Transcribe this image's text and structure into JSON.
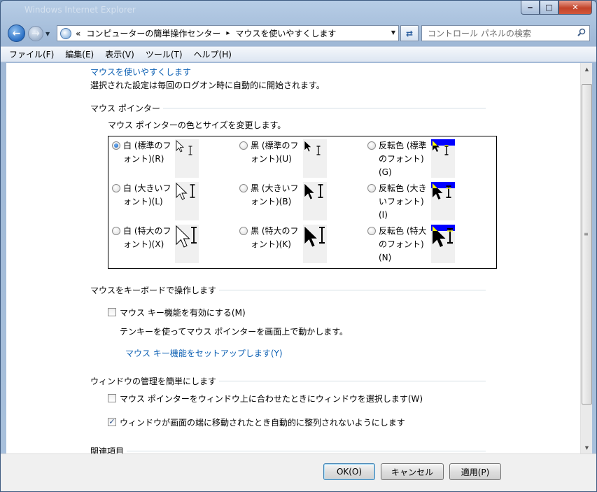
{
  "window": {
    "title": "Windows Internet Explorer"
  },
  "nav": {
    "breadcrumb": [
      "コンピューターの簡単操作センター",
      "マウスを使いやすくします"
    ],
    "breadcrumb_prefix": "«",
    "search_placeholder": "コントロール パネルの検索"
  },
  "menu": {
    "items": [
      "ファイル(F)",
      "編集(E)",
      "表示(V)",
      "ツール(T)",
      "ヘルプ(H)"
    ]
  },
  "page": {
    "title": "マウスを使いやすくします",
    "subtitle": "選択された設定は毎回のログオン時に自動的に開始されます。"
  },
  "pointer_section": {
    "heading": "マウス ポインター",
    "description": "マウス ポインターの色とサイズを変更します。",
    "options": [
      {
        "label": "白 (標準のフォント)(R)",
        "selected": true,
        "style": "white",
        "size": "normal"
      },
      {
        "label": "黒 (標準のフォント)(U)",
        "selected": false,
        "style": "black",
        "size": "normal"
      },
      {
        "label": "反転色 (標準のフォント)(G)",
        "selected": false,
        "style": "inverted",
        "size": "normal"
      },
      {
        "label": "白 (大きいフォント)(L)",
        "selected": false,
        "style": "white",
        "size": "large"
      },
      {
        "label": "黒 (大きいフォント)(B)",
        "selected": false,
        "style": "black",
        "size": "large"
      },
      {
        "label": "反転色 (大きいフォント)(I)",
        "selected": false,
        "style": "inverted",
        "size": "large"
      },
      {
        "label": "白 (特大のフォント)(X)",
        "selected": false,
        "style": "white",
        "size": "xlarge"
      },
      {
        "label": "黒 (特大のフォント)(K)",
        "selected": false,
        "style": "black",
        "size": "xlarge"
      },
      {
        "label": "反転色 (特大のフォント)(N)",
        "selected": false,
        "style": "inverted",
        "size": "xlarge"
      }
    ]
  },
  "keyboard_section": {
    "heading": "マウスをキーボードで操作します",
    "mousekeys_label": "マウス キー機能を有効にする(M)",
    "mousekeys_checked": false,
    "mousekeys_description": "テンキーを使ってマウス ポインターを画面上で動かします。",
    "setup_link": "マウス キー機能をセットアップします(Y)"
  },
  "window_section": {
    "heading": "ウィンドウの管理を簡単にします",
    "hover_activate_label": "マウス ポインターをウィンドウ上に合わせたときにウィンドウを選択します(W)",
    "hover_activate_checked": false,
    "prevent_arrange_label": "ウィンドウが画面の端に移動されたとき自動的に整列されないようにします",
    "prevent_arrange_checked": true
  },
  "related_section": {
    "heading": "関連項目"
  },
  "buttons": {
    "ok": "OK(O)",
    "cancel": "キャンセル",
    "apply": "適用(P)"
  },
  "colors": {
    "link": "#0b5fb3",
    "inverted_band": "#0000ff"
  }
}
